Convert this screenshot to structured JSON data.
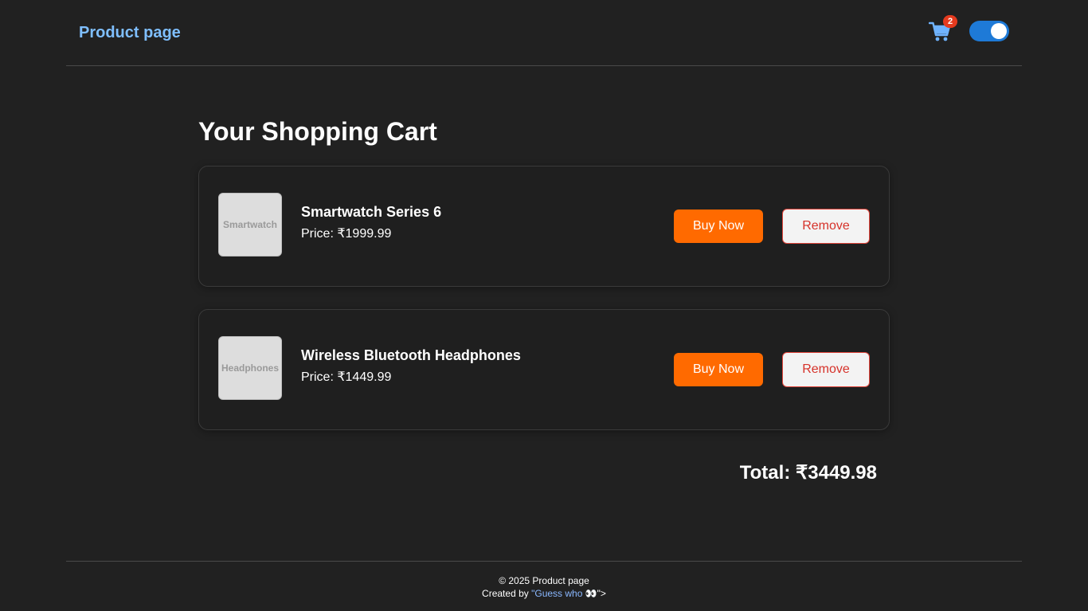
{
  "header": {
    "brand": "Product page",
    "cart_count": "2",
    "cart_icon": "shopping-cart-icon",
    "theme_toggle": "dark-mode-toggle"
  },
  "main": {
    "title": "Your Shopping Cart",
    "items": [
      {
        "thumb_label": "Smartwatch",
        "name": "Smartwatch Series 6",
        "price": "Price: ₹1999.99",
        "buy_label": "Buy Now",
        "remove_label": "Remove"
      },
      {
        "thumb_label": "Headphones",
        "name": "Wireless Bluetooth Headphones",
        "price": "Price: ₹1449.99",
        "buy_label": "Buy Now",
        "remove_label": "Remove"
      }
    ],
    "total": "Total: ₹3449.98"
  },
  "footer": {
    "copyright": "© 2025 Product page",
    "created_by": "Created by ",
    "link_text": "\"Guess who 👀",
    "trailing": "\">"
  },
  "colors": {
    "background": "#212121",
    "brand": "#7fbfff",
    "cart_icon": "#6fb3ff",
    "badge": "#e53a1e",
    "toggle": "#1e7ad7",
    "buy_button": "#ff6a00",
    "remove_text": "#d6322a"
  }
}
